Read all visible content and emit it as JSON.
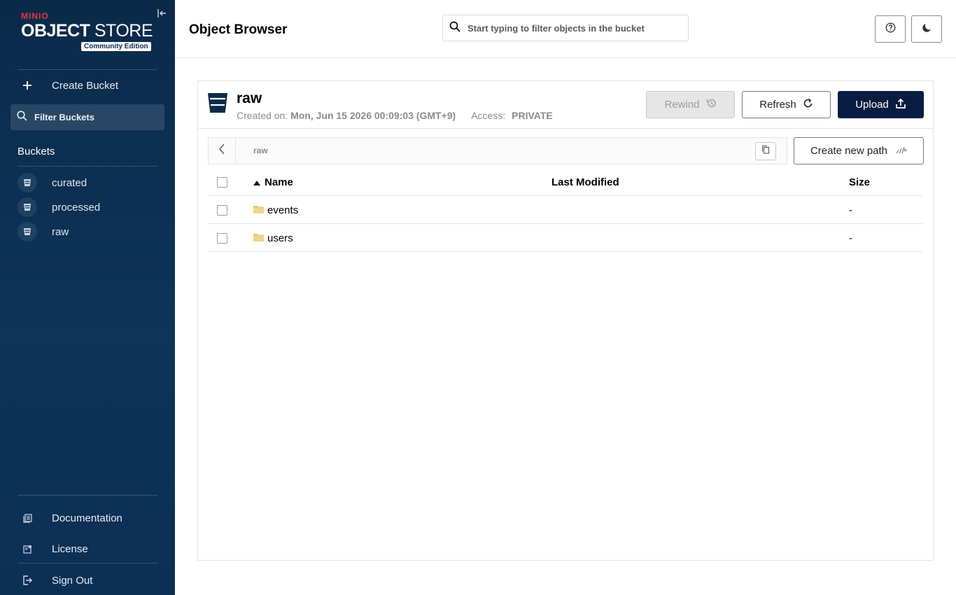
{
  "sidebar": {
    "logo": {
      "brand": "MINIO",
      "title_bold": "OBJECT",
      "title_rest": " STORE",
      "edition": "Community Edition"
    },
    "create_bucket": "Create Bucket",
    "filter_placeholder": "Filter Buckets",
    "buckets_label": "Buckets",
    "buckets": [
      "curated",
      "processed",
      "raw"
    ],
    "bottom": {
      "documentation": "Documentation",
      "license": "License",
      "sign_out": "Sign Out"
    }
  },
  "header": {
    "title": "Object Browser",
    "search_placeholder": "Start typing to filter objects in the bucket"
  },
  "bucket": {
    "name": "raw",
    "created_label": "Created on:",
    "created_value": "Mon, Jun 15 2026 00:09:03 (GMT+9)",
    "access_label": "Access:",
    "access_value": "PRIVATE",
    "actions": {
      "rewind": "Rewind",
      "refresh": "Refresh",
      "upload": "Upload"
    }
  },
  "path": {
    "current": "raw",
    "create_new_path": "Create new path"
  },
  "table": {
    "columns": {
      "name": "Name",
      "last_modified": "Last Modified",
      "size": "Size"
    },
    "rows": [
      {
        "name": "events",
        "last_modified": "",
        "size": "-"
      },
      {
        "name": "users",
        "last_modified": "",
        "size": "-"
      }
    ]
  },
  "colors": {
    "sidebar": "#0b2a4a",
    "primary": "#081c42",
    "accent": "#e0393e",
    "folder": "#e8c66a"
  }
}
